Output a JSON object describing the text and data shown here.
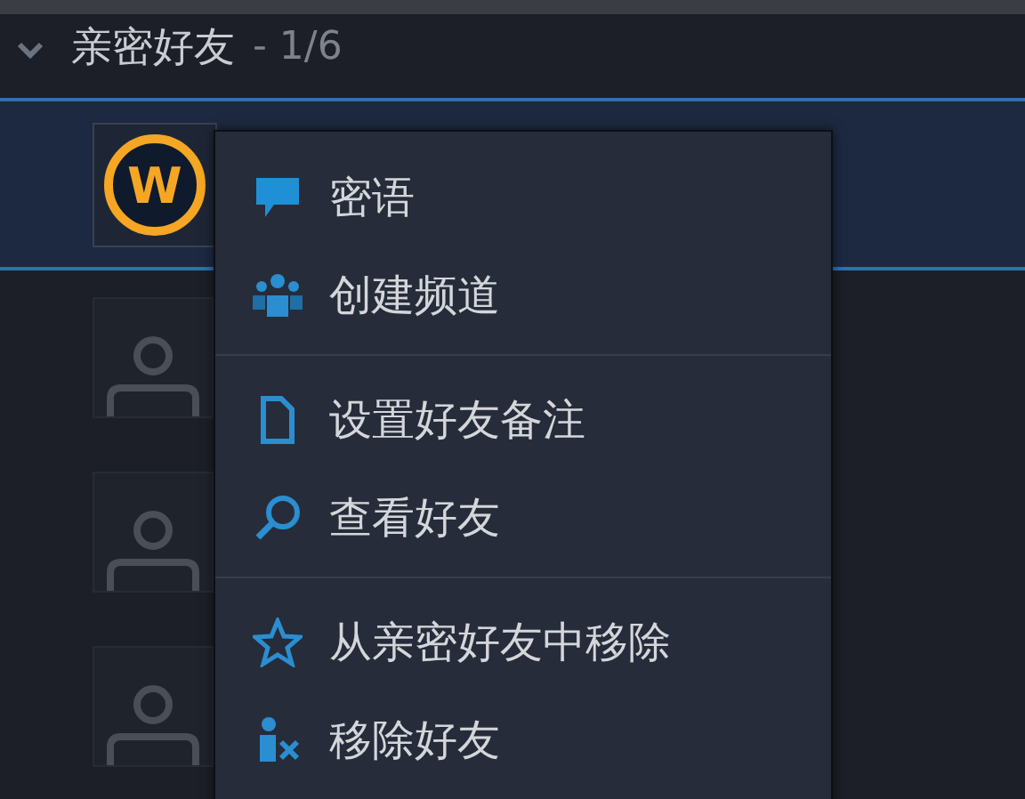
{
  "section": {
    "title": "亲密好友",
    "count": "- 1/6",
    "expanded": true
  },
  "friends": [
    {
      "selected": true,
      "avatar": {
        "kind": "game",
        "letter": "W"
      }
    },
    {
      "selected": false,
      "avatar": {
        "kind": "default"
      }
    },
    {
      "selected": false,
      "avatar": {
        "kind": "default"
      }
    },
    {
      "selected": false,
      "avatar": {
        "kind": "default"
      }
    }
  ],
  "context_menu": {
    "groups": [
      [
        {
          "label": "密语",
          "kind": "chat"
        },
        {
          "label": "创建频道",
          "kind": "group"
        }
      ],
      [
        {
          "label": "设置好友备注",
          "kind": "note"
        },
        {
          "label": "查看好友",
          "kind": "search"
        }
      ],
      [
        {
          "label": "从亲密好友中移除",
          "kind": "star"
        },
        {
          "label": "移除好友",
          "kind": "remove"
        }
      ]
    ]
  }
}
